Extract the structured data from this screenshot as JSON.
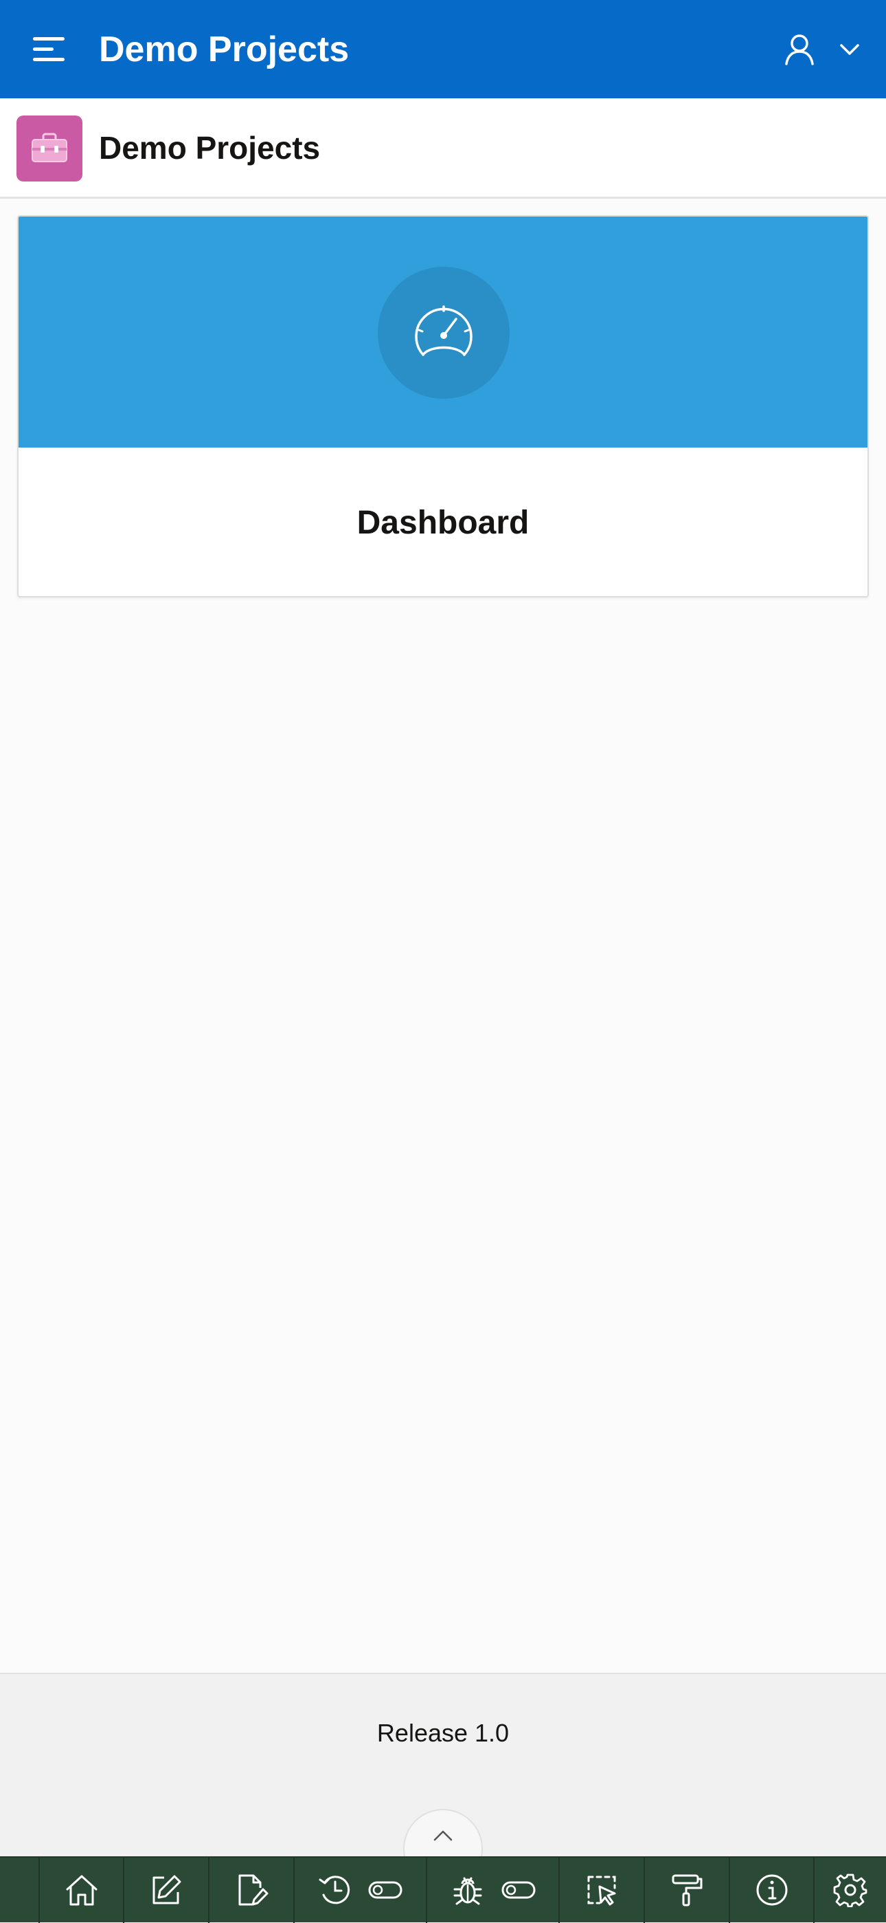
{
  "header": {
    "app_title": "Demo Projects"
  },
  "title_bar": {
    "page_title": "Demo Projects"
  },
  "cards": [
    {
      "label": "Dashboard",
      "icon": "speedometer-icon"
    }
  ],
  "footer": {
    "release": "Release 1.0"
  },
  "colors": {
    "header_bg": "#056ac8",
    "page_icon_bg": "#cb5aa4",
    "card_banner_bg": "#309fdb",
    "toolbar_bg": "#2b4a36"
  },
  "dev_toolbar": {
    "items": [
      "home-icon",
      "edit-icon",
      "edit-page-icon",
      "session-icon",
      "debug-icon",
      "quick-edit-icon",
      "theme-roller-icon",
      "info-icon",
      "settings-icon"
    ]
  }
}
